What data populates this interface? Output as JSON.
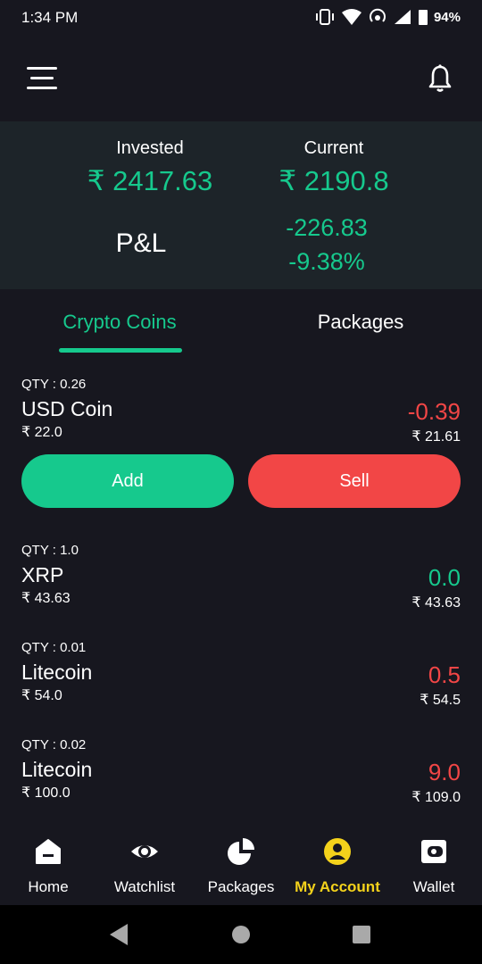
{
  "status_bar": {
    "time": "1:34 PM",
    "battery": "94%"
  },
  "summary": {
    "invested_label": "Invested",
    "invested_value": "₹ 2417.63",
    "current_label": "Current",
    "current_value": "₹ 2190.8",
    "pnl_label": "P&L",
    "pnl_amount": "-226.83",
    "pnl_percent": "-9.38%"
  },
  "tabs": [
    {
      "label": "Crypto Coins",
      "active": true
    },
    {
      "label": "Packages",
      "active": false
    }
  ],
  "holdings": [
    {
      "qty": "QTY : 0.26",
      "name": "USD Coin",
      "price": "₹ 22.0",
      "change": "-0.39",
      "current": "₹ 21.61",
      "trend": "negative",
      "expanded": true
    },
    {
      "qty": "QTY : 1.0",
      "name": "XRP",
      "price": "₹ 43.63",
      "change": "0.0",
      "current": "₹ 43.63",
      "trend": "positive"
    },
    {
      "qty": "QTY : 0.01",
      "name": "Litecoin",
      "price": "₹ 54.0",
      "change": "0.5",
      "current": "₹ 54.5",
      "trend": "negative"
    },
    {
      "qty": "QTY : 0.02",
      "name": "Litecoin",
      "price": "₹ 100.0",
      "change": "9.0",
      "current": "₹ 109.0",
      "trend": "negative"
    }
  ],
  "actions": {
    "add_label": "Add",
    "sell_label": "Sell"
  },
  "bottom_nav": [
    {
      "label": "Home",
      "icon": "home-icon",
      "active": false
    },
    {
      "label": "Watchlist",
      "icon": "eye-icon",
      "active": false
    },
    {
      "label": "Packages",
      "icon": "pie-chart-icon",
      "active": false
    },
    {
      "label": "My Account",
      "icon": "account-icon",
      "active": true
    },
    {
      "label": "Wallet",
      "icon": "wallet-icon",
      "active": false
    }
  ],
  "colors": {
    "background": "#17171f",
    "summary_bg": "#1d2429",
    "accent_green": "#16c98d",
    "accent_red": "#f24646",
    "active_nav": "#f4d21b"
  }
}
